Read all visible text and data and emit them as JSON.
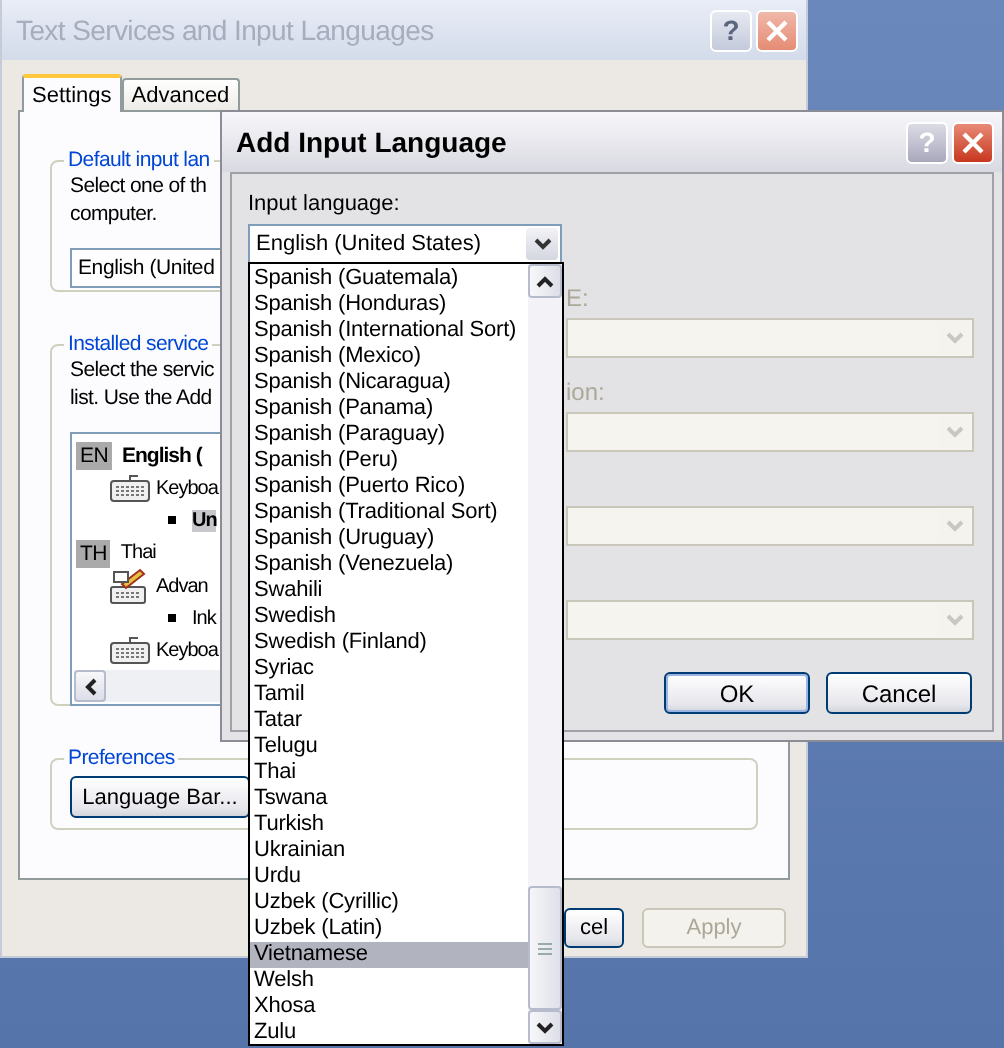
{
  "back_window": {
    "title": "Text Services and Input Languages",
    "help_button": "?",
    "tabs": [
      {
        "label": "Settings",
        "selected": true
      },
      {
        "label": "Advanced",
        "selected": false
      }
    ],
    "default_language": {
      "legend": "Default input lan",
      "text_lines": [
        "Select one of th",
        "computer."
      ],
      "combo_value": "English (United"
    },
    "installed_services": {
      "legend": "Installed service",
      "text_lines": [
        "Select the servic",
        "list. Use the Add"
      ],
      "tree": [
        {
          "badge": "EN",
          "label": "English (",
          "bold": true,
          "children": [
            {
              "kind": "keyboard",
              "label": "Keyboa",
              "children": [
                {
                  "label": "Un",
                  "selected": true
                }
              ]
            }
          ]
        },
        {
          "badge": "TH",
          "label": "Thai",
          "bold": false,
          "children": [
            {
              "kind": "advanced",
              "label": "Advan",
              "children": [
                {
                  "label": "Ink",
                  "selected": false
                }
              ]
            },
            {
              "kind": "keyboard",
              "label": "Keyboa"
            }
          ]
        }
      ]
    },
    "preferences": {
      "legend": "Preferences",
      "button": "Language Bar..."
    },
    "buttons": [
      {
        "label": "cel",
        "disabled": false
      },
      {
        "label": "Apply",
        "disabled": true
      }
    ]
  },
  "dialog": {
    "title": "Add Input Language",
    "help_button": "?",
    "input_language_label": "Input language:",
    "input_language_value": "English (United States)",
    "disabled_fields": [
      {
        "label": "E:",
        "disabled": true
      },
      {
        "label": "ion:",
        "disabled": true
      },
      {
        "disabled": true
      },
      {
        "disabled": true
      }
    ],
    "buttons": [
      {
        "label": "OK",
        "default": true
      },
      {
        "label": "Cancel",
        "default": false
      }
    ],
    "dropdown": {
      "items": [
        {
          "label": "Spanish (Guatemala)",
          "selected": false
        },
        {
          "label": "Spanish (Honduras)",
          "selected": false
        },
        {
          "label": "Spanish (International Sort)",
          "selected": false
        },
        {
          "label": "Spanish (Mexico)",
          "selected": false
        },
        {
          "label": "Spanish (Nicaragua)",
          "selected": false
        },
        {
          "label": "Spanish (Panama)",
          "selected": false
        },
        {
          "label": "Spanish (Paraguay)",
          "selected": false
        },
        {
          "label": "Spanish (Peru)",
          "selected": false
        },
        {
          "label": "Spanish (Puerto Rico)",
          "selected": false
        },
        {
          "label": "Spanish (Traditional Sort)",
          "selected": false
        },
        {
          "label": "Spanish (Uruguay)",
          "selected": false
        },
        {
          "label": "Spanish (Venezuela)",
          "selected": false
        },
        {
          "label": "Swahili",
          "selected": false
        },
        {
          "label": "Swedish",
          "selected": false
        },
        {
          "label": "Swedish (Finland)",
          "selected": false
        },
        {
          "label": "Syriac",
          "selected": false
        },
        {
          "label": "Tamil",
          "selected": false
        },
        {
          "label": "Tatar",
          "selected": false
        },
        {
          "label": "Telugu",
          "selected": false
        },
        {
          "label": "Thai",
          "selected": false
        },
        {
          "label": "Tswana",
          "selected": false
        },
        {
          "label": "Turkish",
          "selected": false
        },
        {
          "label": "Ukrainian",
          "selected": false
        },
        {
          "label": "Urdu",
          "selected": false
        },
        {
          "label": "Uzbek (Cyrillic)",
          "selected": false
        },
        {
          "label": "Uzbek (Latin)",
          "selected": false
        },
        {
          "label": "Vietnamese",
          "selected": true
        },
        {
          "label": "Welsh",
          "selected": false
        },
        {
          "label": "Xhosa",
          "selected": false
        },
        {
          "label": "Zulu",
          "selected": false
        }
      ]
    }
  }
}
